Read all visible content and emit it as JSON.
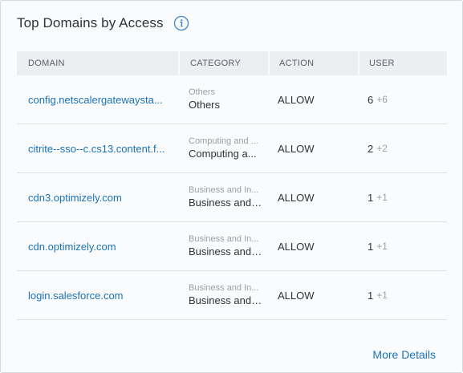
{
  "card": {
    "title": "Top Domains by Access",
    "more_details": "More Details"
  },
  "table": {
    "headers": {
      "domain": "DOMAIN",
      "category": "CATEGORY",
      "action": "ACTION",
      "user": "USER"
    },
    "rows": [
      {
        "domain": "config.netscalergatewaysta...",
        "category_small": "Others",
        "category": "Others",
        "action": "ALLOW",
        "users": "6",
        "delta": "+6"
      },
      {
        "domain": "citrite--sso--c.cs13.content.f...",
        "category_small": "Computing and ...",
        "category": "Computing a...",
        "action": "ALLOW",
        "users": "2",
        "delta": "+2"
      },
      {
        "domain": "cdn3.optimizely.com",
        "category_small": "Business and In...",
        "category": "Business and ...",
        "action": "ALLOW",
        "users": "1",
        "delta": "+1"
      },
      {
        "domain": "cdn.optimizely.com",
        "category_small": "Business and In...",
        "category": "Business and ...",
        "action": "ALLOW",
        "users": "1",
        "delta": "+1"
      },
      {
        "domain": "login.salesforce.com",
        "category_small": "Business and In...",
        "category": "Business and ...",
        "action": "ALLOW",
        "users": "1",
        "delta": "+1"
      }
    ]
  },
  "colors": {
    "link": "#1a73b8",
    "header_bg": "#eceef1",
    "muted": "#9aa0a6"
  },
  "icons": {
    "info": "info-icon"
  }
}
